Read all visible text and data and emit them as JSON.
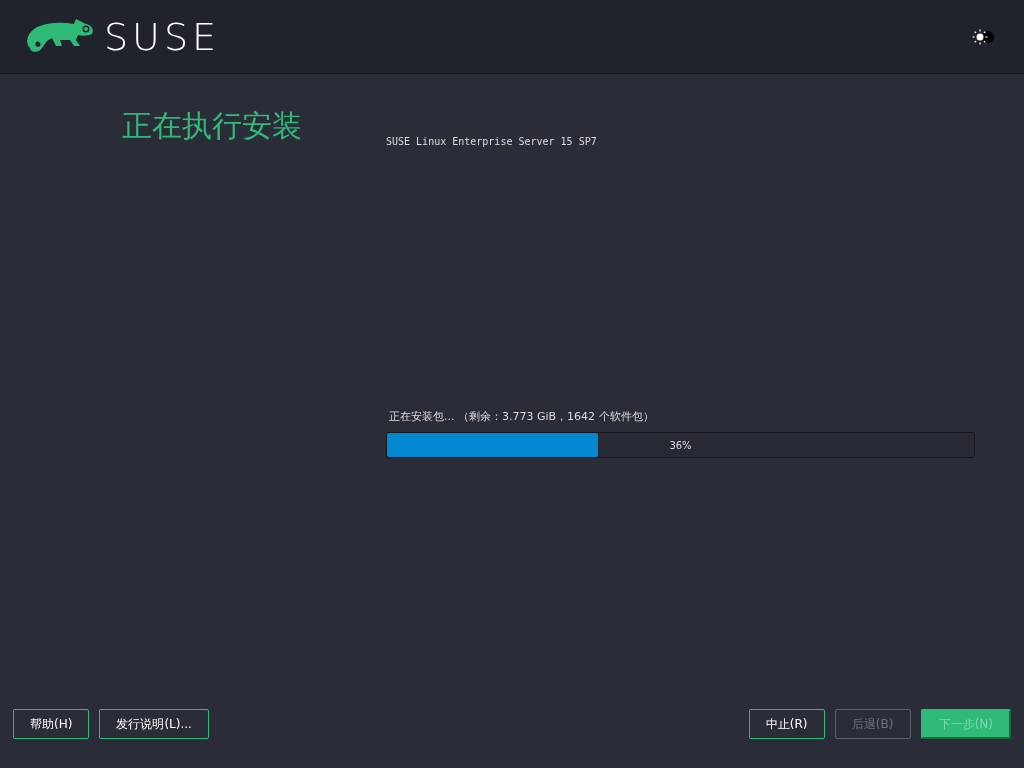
{
  "header": {
    "logo_text": "SUSE"
  },
  "title": "正在执行安装",
  "product": "SUSE Linux Enterprise Server 15 SP7",
  "progress": {
    "label": "正在安装包... （剩余：3.773 GiB，1642 个软件包）",
    "level": 0.36,
    "reading": "36%"
  },
  "buttons_left": [
    {
      "label": "帮助(H)",
      "kind": "outline",
      "disabled": false
    },
    {
      "label": "发行说明(L)...",
      "kind": "outline",
      "disabled": false
    }
  ],
  "buttons_right": [
    {
      "label": "中止(R)",
      "kind": "outline",
      "disabled": false
    },
    {
      "label": "后退(B)",
      "kind": "outline",
      "disabled": true
    },
    {
      "label": "下一步(N)",
      "kind": "primary",
      "disabled": true
    }
  ]
}
